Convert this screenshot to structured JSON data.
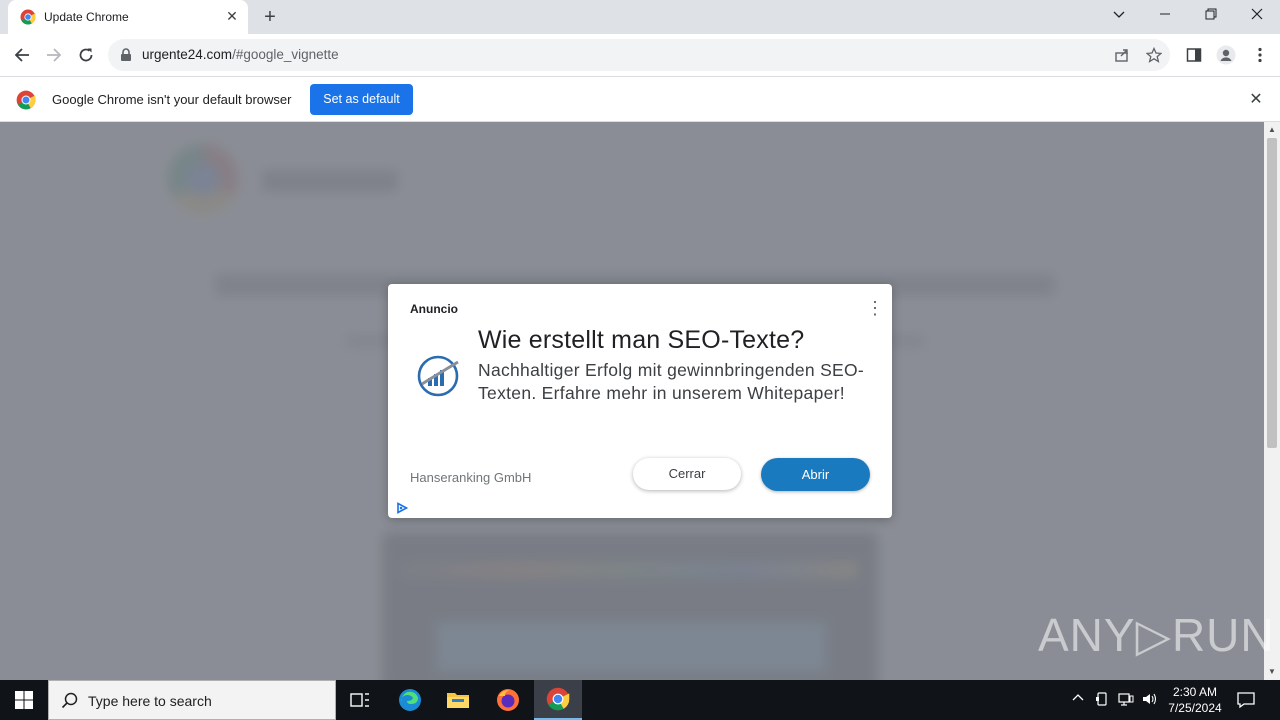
{
  "browser": {
    "tab_title": "Update Chrome",
    "tab_close": "✕",
    "new_tab": "+",
    "url_domain": "urgente24.com",
    "url_path": "/#google_vignette",
    "window_controls": {
      "minimize": "—",
      "restore": "❐",
      "close": "✕"
    }
  },
  "infobar": {
    "message": "Google Chrome isn't your default browser",
    "button": "Set as default",
    "close": "✕"
  },
  "ad": {
    "label": "Anuncio",
    "menu": "⋮",
    "headline": "Wie erstellt man SEO-Texte?",
    "body": "Nachhaltiger Erfolg mit gewinnbringenden SEO-Texten. Erfahre mehr in unserem Whitepaper!",
    "advertiser": "Hanseranking GmbH",
    "close_button": "Cerrar",
    "open_button": "Abrir",
    "accent_color": "#1a7ac0"
  },
  "watermark": "ANY▷RUN",
  "taskbar": {
    "search_placeholder": "Type here to search",
    "time": "2:30 AM",
    "date": "7/25/2024"
  }
}
